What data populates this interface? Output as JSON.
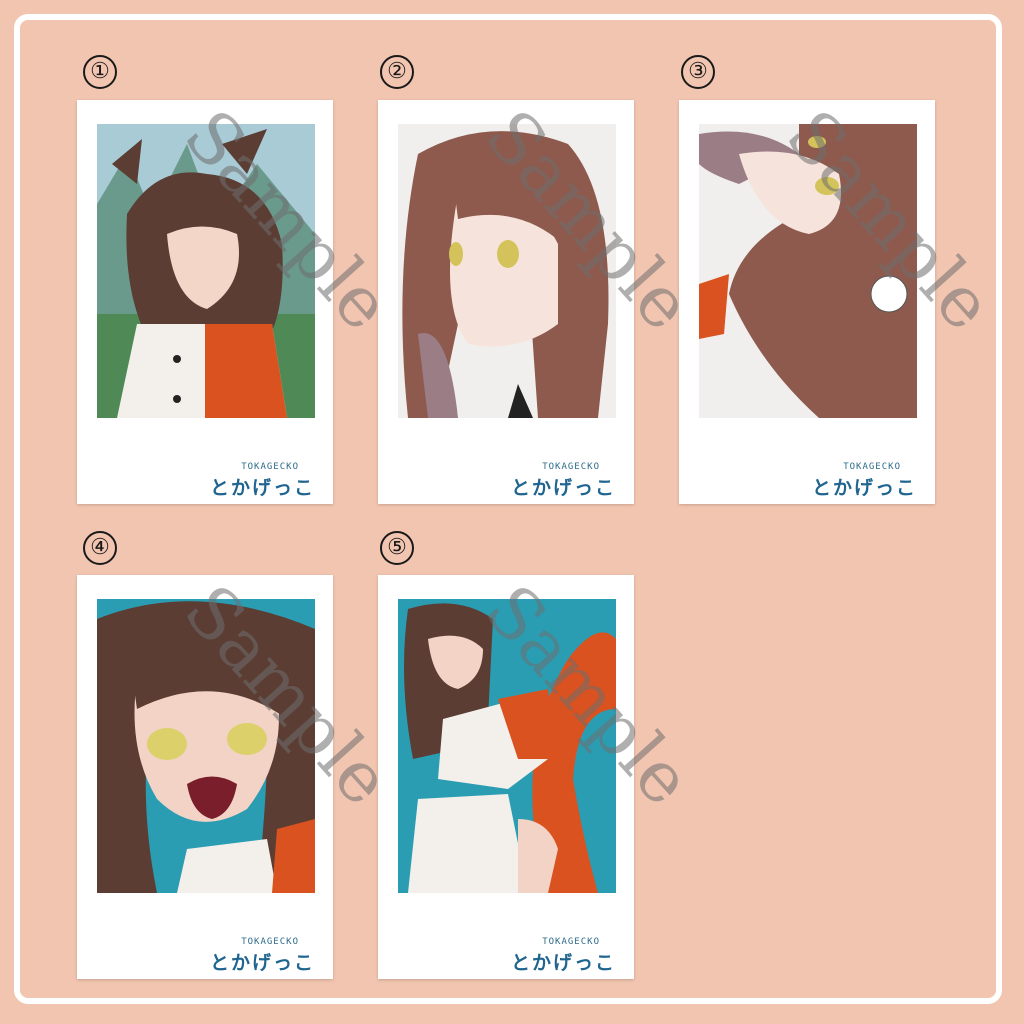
{
  "colors": {
    "background": "#f2c5b0",
    "frame": "#ffffff",
    "brand": "#1f6590",
    "watermark": "#6e6e6e"
  },
  "cards": [
    {
      "number": "①",
      "brand_en": "TOKAGECKO",
      "brand_jp": "とかげっこ",
      "watermark": "Sample"
    },
    {
      "number": "②",
      "brand_en": "TOKAGECKO",
      "brand_jp": "とかげっこ",
      "watermark": "Sample"
    },
    {
      "number": "③",
      "brand_en": "TOKAGECKO",
      "brand_jp": "とかげっこ",
      "watermark": "Sample"
    },
    {
      "number": "④",
      "brand_en": "TOKAGECKO",
      "brand_jp": "とかげっこ",
      "watermark": "Sample"
    },
    {
      "number": "⑤",
      "brand_en": "TOKAGECKO",
      "brand_jp": "とかげっこ",
      "watermark": "Sample"
    }
  ]
}
